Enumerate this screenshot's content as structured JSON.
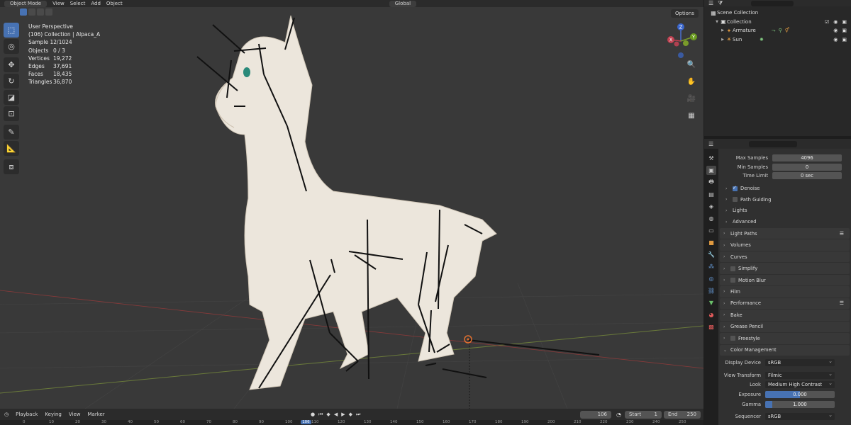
{
  "viewport": {
    "mode": "Object Mode",
    "menus": [
      "View",
      "Select",
      "Add",
      "Object"
    ],
    "orientation": "Global",
    "options_label": "Options",
    "stats": {
      "line1": "User Perspective",
      "line2": "(106) Collection | Alpaca_A",
      "line3": "Sample 12/1024",
      "rows": [
        {
          "k": "Objects",
          "v": "0 / 3"
        },
        {
          "k": "Vertices",
          "v": "19,272"
        },
        {
          "k": "Edges",
          "v": "37,691"
        },
        {
          "k": "Faces",
          "v": "18,435"
        },
        {
          "k": "Triangles",
          "v": "36,870"
        }
      ]
    },
    "gizmo": {
      "z": "Z",
      "y": "Y",
      "x": "X"
    }
  },
  "outliner": {
    "search_placeholder": "",
    "items": [
      {
        "label": "Scene Collection"
      },
      {
        "label": "Collection"
      },
      {
        "label": "Armature"
      },
      {
        "label": "Sun"
      }
    ]
  },
  "properties": {
    "sampling": [
      {
        "label": "Max Samples",
        "value": "4096"
      },
      {
        "label": "Min Samples",
        "value": "0"
      },
      {
        "label": "Time Limit",
        "value": "0 sec"
      }
    ],
    "subpanels": [
      {
        "label": "Denoise",
        "checkbox": true,
        "checked": true
      },
      {
        "label": "Path Guiding",
        "checkbox": true,
        "checked": false
      },
      {
        "label": "Lights",
        "checkbox": false
      },
      {
        "label": "Advanced",
        "checkbox": false
      }
    ],
    "panels": [
      {
        "label": "Light Paths",
        "checkbox": false,
        "list": true
      },
      {
        "label": "Volumes",
        "checkbox": false,
        "list": false
      },
      {
        "label": "Curves",
        "checkbox": false,
        "list": false
      },
      {
        "label": "Simplify",
        "checkbox": true,
        "list": false
      },
      {
        "label": "Motion Blur",
        "checkbox": true,
        "list": false
      },
      {
        "label": "Film",
        "checkbox": false,
        "list": false
      },
      {
        "label": "Performance",
        "checkbox": false,
        "list": true
      },
      {
        "label": "Bake",
        "checkbox": false,
        "list": false
      },
      {
        "label": "Grease Pencil",
        "checkbox": false,
        "list": false
      },
      {
        "label": "Freestyle",
        "checkbox": true,
        "list": false
      }
    ],
    "color_management": {
      "title": "Color Management",
      "display_device": {
        "label": "Display Device",
        "value": "sRGB"
      },
      "view_transform": {
        "label": "View Transform",
        "value": "Filmic"
      },
      "look": {
        "label": "Look",
        "value": "Medium High Contrast"
      },
      "exposure": {
        "label": "Exposure",
        "value": "0.000",
        "fill": 0.5
      },
      "gamma": {
        "label": "Gamma",
        "value": "1.000",
        "fill": 0.1
      },
      "sequencer": {
        "label": "Sequencer",
        "value": "sRGB"
      }
    }
  },
  "timeline": {
    "menus": [
      "Playback",
      "Keying",
      "View",
      "Marker"
    ],
    "current_frame": "106",
    "start_label": "Start",
    "start_value": "1",
    "end_label": "End",
    "end_value": "250",
    "ruler": [
      "0",
      "10",
      "20",
      "30",
      "40",
      "50",
      "60",
      "70",
      "80",
      "90",
      "100",
      "106",
      "110",
      "120",
      "130",
      "140",
      "150",
      "160",
      "170",
      "180",
      "190",
      "200",
      "210",
      "220",
      "230",
      "240",
      "250"
    ]
  }
}
